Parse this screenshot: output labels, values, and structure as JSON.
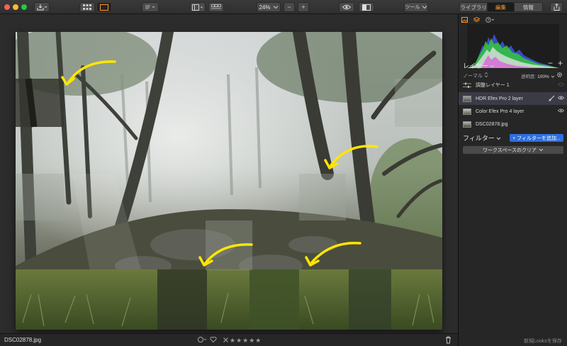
{
  "toolbar": {
    "zoom": "24%",
    "zoom_minus": "−",
    "zoom_plus": "+",
    "tools_menu": "ツール",
    "tabs": [
      {
        "label": "ライブラリ",
        "active": false
      },
      {
        "label": "編集",
        "active": true
      },
      {
        "label": "情報",
        "active": false
      }
    ]
  },
  "canvas": {
    "photo_description_icons": [
      "forest-photo"
    ],
    "arrow_color": "#ffe600"
  },
  "bottombar": {
    "filename": "DSC02878.jpg",
    "rating": "★★★★★"
  },
  "panel": {
    "layers_title": "レイヤー",
    "blend_mode": "ノーマル",
    "opacity_label": "透明度:",
    "opacity_value": "100%",
    "layers": [
      {
        "label": "調整レイヤー 1",
        "selected": false
      },
      {
        "label": "HDR Efex Pro 2 layer",
        "selected": true
      },
      {
        "label": "Color Efex Pro 4 layer",
        "selected": false
      },
      {
        "label": "DSC02878.jpg",
        "selected": false
      }
    ],
    "filters_title": "フィルター",
    "add_filter": "+ フィルターを追加...",
    "clear_workspace": "ワークスペースのクリア",
    "save_looks": "新規Looksを保存"
  },
  "colors": {
    "accent_orange": "#ff9a2b",
    "accent_blue": "#2d6fe0",
    "selected_row": "#3b3b46"
  }
}
